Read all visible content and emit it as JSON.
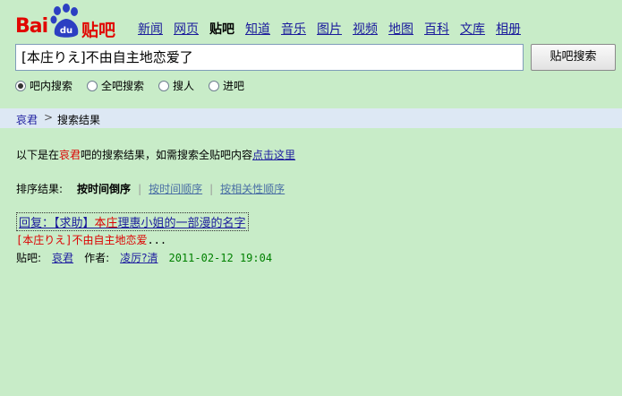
{
  "logo": {
    "bai": "Bai",
    "du": "du",
    "tieba": "贴吧"
  },
  "nav": [
    {
      "label": "新闻",
      "active": false
    },
    {
      "label": "网页",
      "active": false
    },
    {
      "label": "贴吧",
      "active": true
    },
    {
      "label": "知道",
      "active": false
    },
    {
      "label": "音乐",
      "active": false
    },
    {
      "label": "图片",
      "active": false
    },
    {
      "label": "视频",
      "active": false
    },
    {
      "label": "地图",
      "active": false
    },
    {
      "label": "百科",
      "active": false
    },
    {
      "label": "文库",
      "active": false
    },
    {
      "label": "相册",
      "active": false
    }
  ],
  "search": {
    "value": "[本庄りえ]不由自主地恋爱了",
    "button": "贴吧搜索"
  },
  "radios": [
    {
      "label": "吧内搜索",
      "checked": true
    },
    {
      "label": "全吧搜索",
      "checked": false
    },
    {
      "label": "搜人",
      "checked": false
    },
    {
      "label": "进吧",
      "checked": false
    }
  ],
  "breadcrumb": {
    "bar": "哀君",
    "sep": ">",
    "current": "搜索结果"
  },
  "info": {
    "prefix": "以下是在",
    "bar": "哀君",
    "middle": "吧的搜索结果，如需搜索全贴吧内容",
    "link": "点击这里"
  },
  "sort": {
    "label": "排序结果:",
    "current": "按时间倒序",
    "sep": "|",
    "option1": "按时间顺序",
    "option2": "按相关性顺序"
  },
  "result": {
    "title_prefix": "回复：【求助】",
    "title_highlight": "本庄",
    "title_suffix": "理惠小姐的一部漫的名字",
    "snippet_highlight": "[本庄りえ]不由自主地恋爱",
    "snippet_rest": "...",
    "bar_label": "贴吧:",
    "bar": "哀君",
    "author_label": "作者:",
    "author": "凌厉?清",
    "time": "2011-02-12 19:04"
  },
  "colors": {
    "background": "#c8ecc8",
    "brand_red": "#e10600",
    "highlight": "#dd0000",
    "time_green": "#008000"
  }
}
